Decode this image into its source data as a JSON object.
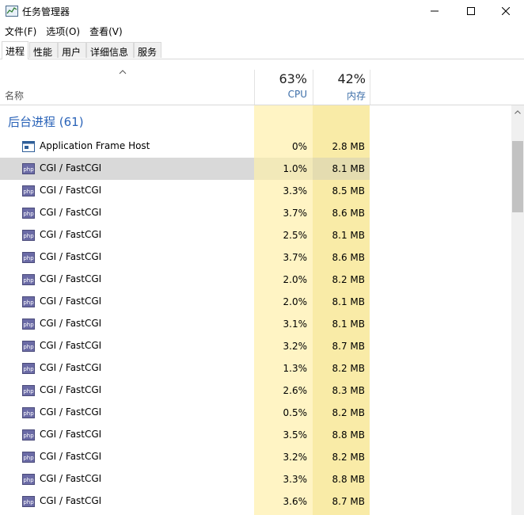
{
  "window": {
    "title": "任务管理器"
  },
  "menu": [
    {
      "label": "文件(F)"
    },
    {
      "label": "选项(O)"
    },
    {
      "label": "查看(V)"
    }
  ],
  "tabs": [
    {
      "label": "进程",
      "active": true
    },
    {
      "label": "性能",
      "active": false
    },
    {
      "label": "用户",
      "active": false
    },
    {
      "label": "详细信息",
      "active": false
    },
    {
      "label": "服务",
      "active": false
    }
  ],
  "columns": {
    "name_label": "名称",
    "cpu_pct": "63%",
    "cpu_label": "CPU",
    "mem_pct": "42%",
    "mem_label": "内存"
  },
  "group": {
    "title": "后台进程 (61)"
  },
  "processes": [
    {
      "name": "Application Frame Host",
      "icon": "app-frame-icon",
      "cpu": "0%",
      "mem": "2.8 MB",
      "selected": false
    },
    {
      "name": "CGI / FastCGI",
      "icon": "php-icon",
      "cpu": "1.0%",
      "mem": "8.1 MB",
      "selected": true
    },
    {
      "name": "CGI / FastCGI",
      "icon": "php-icon",
      "cpu": "3.3%",
      "mem": "8.5 MB",
      "selected": false
    },
    {
      "name": "CGI / FastCGI",
      "icon": "php-icon",
      "cpu": "3.7%",
      "mem": "8.6 MB",
      "selected": false
    },
    {
      "name": "CGI / FastCGI",
      "icon": "php-icon",
      "cpu": "2.5%",
      "mem": "8.1 MB",
      "selected": false
    },
    {
      "name": "CGI / FastCGI",
      "icon": "php-icon",
      "cpu": "3.7%",
      "mem": "8.6 MB",
      "selected": false
    },
    {
      "name": "CGI / FastCGI",
      "icon": "php-icon",
      "cpu": "2.0%",
      "mem": "8.2 MB",
      "selected": false
    },
    {
      "name": "CGI / FastCGI",
      "icon": "php-icon",
      "cpu": "2.0%",
      "mem": "8.1 MB",
      "selected": false
    },
    {
      "name": "CGI / FastCGI",
      "icon": "php-icon",
      "cpu": "3.1%",
      "mem": "8.1 MB",
      "selected": false
    },
    {
      "name": "CGI / FastCGI",
      "icon": "php-icon",
      "cpu": "3.2%",
      "mem": "8.7 MB",
      "selected": false
    },
    {
      "name": "CGI / FastCGI",
      "icon": "php-icon",
      "cpu": "1.3%",
      "mem": "8.2 MB",
      "selected": false
    },
    {
      "name": "CGI / FastCGI",
      "icon": "php-icon",
      "cpu": "2.6%",
      "mem": "8.3 MB",
      "selected": false
    },
    {
      "name": "CGI / FastCGI",
      "icon": "php-icon",
      "cpu": "0.5%",
      "mem": "8.2 MB",
      "selected": false
    },
    {
      "name": "CGI / FastCGI",
      "icon": "php-icon",
      "cpu": "3.5%",
      "mem": "8.8 MB",
      "selected": false
    },
    {
      "name": "CGI / FastCGI",
      "icon": "php-icon",
      "cpu": "3.2%",
      "mem": "8.2 MB",
      "selected": false
    },
    {
      "name": "CGI / FastCGI",
      "icon": "php-icon",
      "cpu": "3.3%",
      "mem": "8.8 MB",
      "selected": false
    },
    {
      "name": "CGI / FastCGI",
      "icon": "php-icon",
      "cpu": "3.6%",
      "mem": "8.7 MB",
      "selected": false
    }
  ],
  "colors": {
    "accent": "#2a63b8",
    "cpu_heat": "#fff4c4",
    "mem_heat": "#f9eba7",
    "selected": "#d9d9d9"
  }
}
